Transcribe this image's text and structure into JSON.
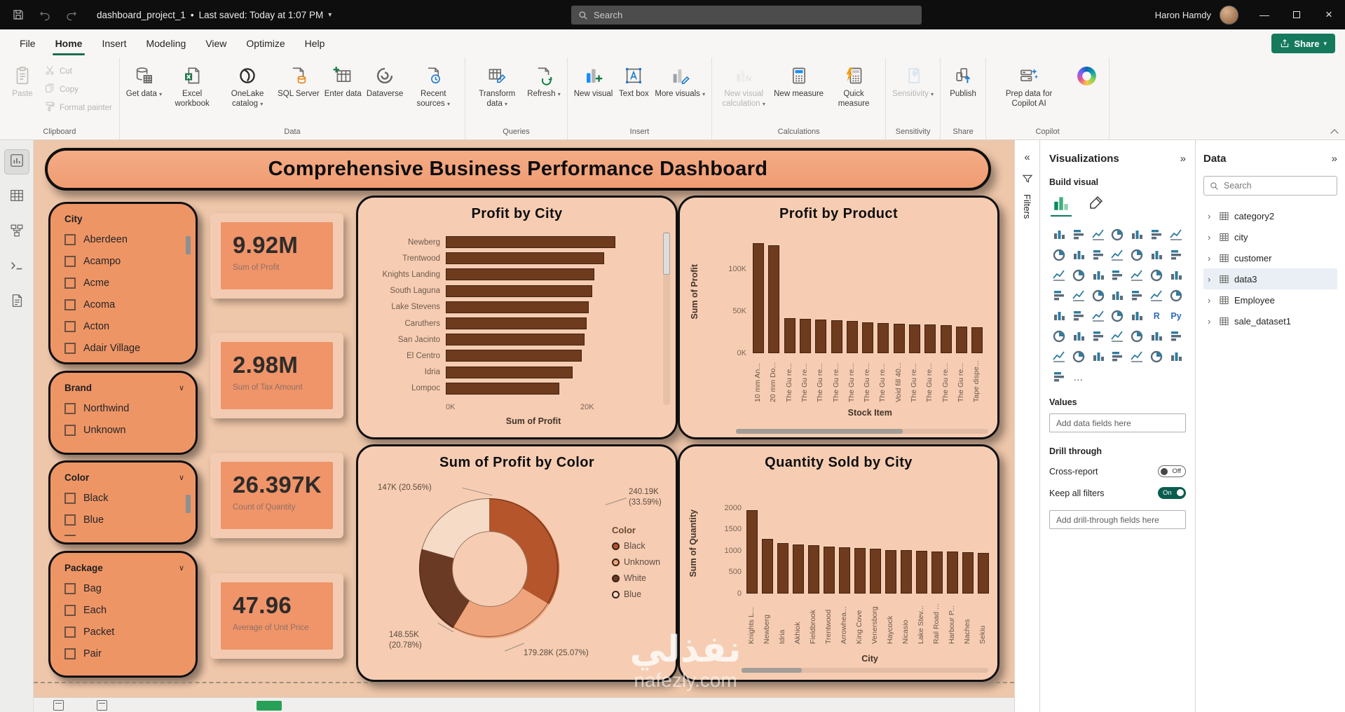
{
  "titlebar": {
    "app_title": "dashboard_project_1",
    "separator": "•",
    "saved_status": "Last saved: Today at 1:07 PM",
    "search_placeholder": "Search",
    "user_name": "Haron Hamdy"
  },
  "menubar": {
    "items": [
      "File",
      "Home",
      "Insert",
      "Modeling",
      "View",
      "Optimize",
      "Help"
    ],
    "active_item": "Home",
    "share_label": "Share"
  },
  "ribbon": {
    "groups": [
      {
        "label": "Clipboard",
        "layout": "clipboard",
        "items": [
          {
            "label": "Paste",
            "icon": "paste-icon",
            "disabled": true,
            "big": true
          },
          {
            "label": "Cut",
            "icon": "cut-icon",
            "disabled": true
          },
          {
            "label": "Copy",
            "icon": "copy-icon",
            "disabled": true
          },
          {
            "label": "Format painter",
            "icon": "format-painter-icon",
            "disabled": true
          }
        ]
      },
      {
        "label": "Data",
        "items": [
          {
            "label": "Get data",
            "icon": "get-data-icon",
            "chevron": true
          },
          {
            "label": "Excel workbook",
            "icon": "excel-workbook-icon"
          },
          {
            "label": "OneLake catalog",
            "icon": "onelake-catalog-icon",
            "chevron": true
          },
          {
            "label": "SQL Server",
            "icon": "sql-server-icon"
          },
          {
            "label": "Enter data",
            "icon": "enter-data-icon"
          },
          {
            "label": "Dataverse",
            "icon": "dataverse-icon"
          },
          {
            "label": "Recent sources",
            "icon": "recent-sources-icon",
            "chevron": true
          }
        ]
      },
      {
        "label": "Queries",
        "items": [
          {
            "label": "Transform data",
            "icon": "transform-data-icon",
            "chevron": true
          },
          {
            "label": "Refresh",
            "icon": "refresh-icon",
            "chevron": true
          }
        ]
      },
      {
        "label": "Insert",
        "items": [
          {
            "label": "New visual",
            "icon": "new-visual-icon"
          },
          {
            "label": "Text box",
            "icon": "text-box-icon"
          },
          {
            "label": "More visuals",
            "icon": "more-visuals-icon",
            "chevron": true
          }
        ]
      },
      {
        "label": "Calculations",
        "items": [
          {
            "label": "New visual calculation",
            "icon": "new-visual-calculation-icon",
            "chevron": true,
            "disabled": true
          },
          {
            "label": "New measure",
            "icon": "new-measure-icon"
          },
          {
            "label": "Quick measure",
            "icon": "quick-measure-icon"
          }
        ]
      },
      {
        "label": "Sensitivity",
        "items": [
          {
            "label": "Sensitivity",
            "icon": "sensitivity-icon",
            "chevron": true,
            "disabled": true
          }
        ]
      },
      {
        "label": "Share",
        "items": [
          {
            "label": "Publish",
            "icon": "publish-icon"
          }
        ]
      },
      {
        "label": "Copilot",
        "items": [
          {
            "label": "Prep data for Copilot AI",
            "icon": "prep-copilot-icon"
          },
          {
            "label": "",
            "icon": "copilot-logo-icon"
          }
        ]
      }
    ]
  },
  "left_rail": {
    "views": [
      {
        "name": "report-view",
        "active": true
      },
      {
        "name": "table-view"
      },
      {
        "name": "model-view"
      },
      {
        "name": "dax-query-view"
      },
      {
        "name": "tmdl-view"
      }
    ]
  },
  "canvas": {
    "banner_title": "Comprehensive Business Performance Dashboard",
    "slicers": [
      {
        "title": "City",
        "items": [
          "Aberdeen",
          "Acampo",
          "Acme",
          "Acoma",
          "Acton",
          "Adair Village"
        ],
        "chevron": false,
        "scrollbar": true
      },
      {
        "title": "Brand",
        "items": [
          "Northwind",
          "Unknown"
        ],
        "chevron": true
      },
      {
        "title": "Color",
        "items": [
          "Black",
          "Blue"
        ],
        "chevron": true,
        "scrollbar": true,
        "partial_next": true
      },
      {
        "title": "Package",
        "items": [
          "Bag",
          "Each",
          "Packet",
          "Pair"
        ],
        "chevron": true
      }
    ],
    "kpis": [
      {
        "value": "9.92M",
        "label": "Sum of Profit"
      },
      {
        "value": "2.98M",
        "label": "Sum of Tax Amount"
      },
      {
        "value": "26.397K",
        "label": "Count of Quantity"
      },
      {
        "value": "47.96",
        "label": "Average of Unit Price"
      }
    ],
    "watermark": {
      "line1": "نفذلي",
      "line2": "nafezly.com"
    }
  },
  "chart_data": [
    {
      "type": "bar",
      "orientation": "horizontal",
      "title": "Profit by City",
      "xlabel": "Sum of Profit",
      "xticks": [
        "0K",
        "20K"
      ],
      "xlim_k": [
        0,
        25.5
      ],
      "categories": [
        "Newberg",
        "Trentwood",
        "Knights Landing",
        "South Laguna",
        "Lake Stevens",
        "Caruthers",
        "San Jacinto",
        "El Centro",
        "Idria",
        "Lompoc"
      ],
      "values_k": [
        25.2,
        23.5,
        22.1,
        21.8,
        21.3,
        20.9,
        20.6,
        20.2,
        18.9,
        16.9
      ]
    },
    {
      "type": "bar",
      "orientation": "vertical",
      "title": "Profit by Product",
      "ylabel": "Sum of Profit",
      "xlabel": "Stock Item",
      "yticks": [
        "0K",
        "50K",
        "100K"
      ],
      "ylim_k": [
        0,
        140
      ],
      "categories": [
        "10 mm An...",
        "20 mm Do...",
        "The Gu re...",
        "The Gu re...",
        "The Gu re...",
        "The Gu re...",
        "The Gu re...",
        "The Gu re...",
        "The Gu re...",
        "Void fill 40...",
        "The Gu re...",
        "The Gu re...",
        "The Gu re...",
        "The Gu re...",
        "Tape dispe..."
      ],
      "values_k": [
        131,
        128,
        42,
        41,
        40,
        39,
        38,
        37,
        36,
        35,
        34.5,
        34,
        33,
        32,
        31
      ]
    },
    {
      "type": "donut",
      "title": "Sum of Profit by Color",
      "legend_title": "Color",
      "legend_position": "right",
      "slices": [
        {
          "name": "Black",
          "value": "240.19K",
          "pct": 33.59,
          "color": "#b4552b",
          "label": "240.19K (33.59%)"
        },
        {
          "name": "Unknown",
          "value": "179.28K",
          "pct": 25.07,
          "color": "#efa47c",
          "label": "179.28K (25.07%)"
        },
        {
          "name": "White",
          "value": "148.55K",
          "pct": 20.78,
          "color": "#6b3a24",
          "label": "148.55K (20.78%)"
        },
        {
          "name": "Blue",
          "value": "147K",
          "pct": 20.56,
          "color": "#f6dcc6",
          "label": "147K (20.56%)"
        }
      ]
    },
    {
      "type": "bar",
      "orientation": "vertical",
      "title": "Quantity Sold by City",
      "ylabel": "Sum of Quantity",
      "xlabel": "City",
      "yticks": [
        "0",
        "500",
        "1000",
        "1500",
        "2000"
      ],
      "ylim": [
        0,
        2000
      ],
      "categories": [
        "Knights L...",
        "Newberg",
        "Idria",
        "Akhiok",
        "Fieldbrook",
        "Trentwood",
        "Arrowhea...",
        "King Cove",
        "Venersborg",
        "Haycock",
        "Nicasio",
        "Lake Stev...",
        "Rail Road ...",
        "Harbour P...",
        "Naches",
        "Sekiu"
      ],
      "values": [
        1950,
        1270,
        1180,
        1150,
        1120,
        1100,
        1080,
        1060,
        1040,
        1020,
        1005,
        995,
        985,
        975,
        965,
        950
      ]
    }
  ],
  "filters_pane": {
    "label": "Filters"
  },
  "visualizations_panel": {
    "title": "Visualizations",
    "build_visual_label": "Build visual",
    "values_label": "Values",
    "add_data_placeholder": "Add data fields here",
    "drill_through_label": "Drill through",
    "cross_report_label": "Cross-report",
    "cross_report_state": "Off",
    "keep_all_filters_label": "Keep all filters",
    "keep_all_filters_state": "On",
    "add_drill_placeholder": "Add drill-through fields here",
    "gallery_special": {
      "r_label": "R",
      "py_label": "Py",
      "more_label": "…"
    }
  },
  "data_panel": {
    "title": "Data",
    "search_placeholder": "Search",
    "tables": [
      {
        "name": "category2"
      },
      {
        "name": "city"
      },
      {
        "name": "customer"
      },
      {
        "name": "data3",
        "selected": true
      },
      {
        "name": "Employee"
      },
      {
        "name": "sale_dataset1"
      }
    ]
  }
}
